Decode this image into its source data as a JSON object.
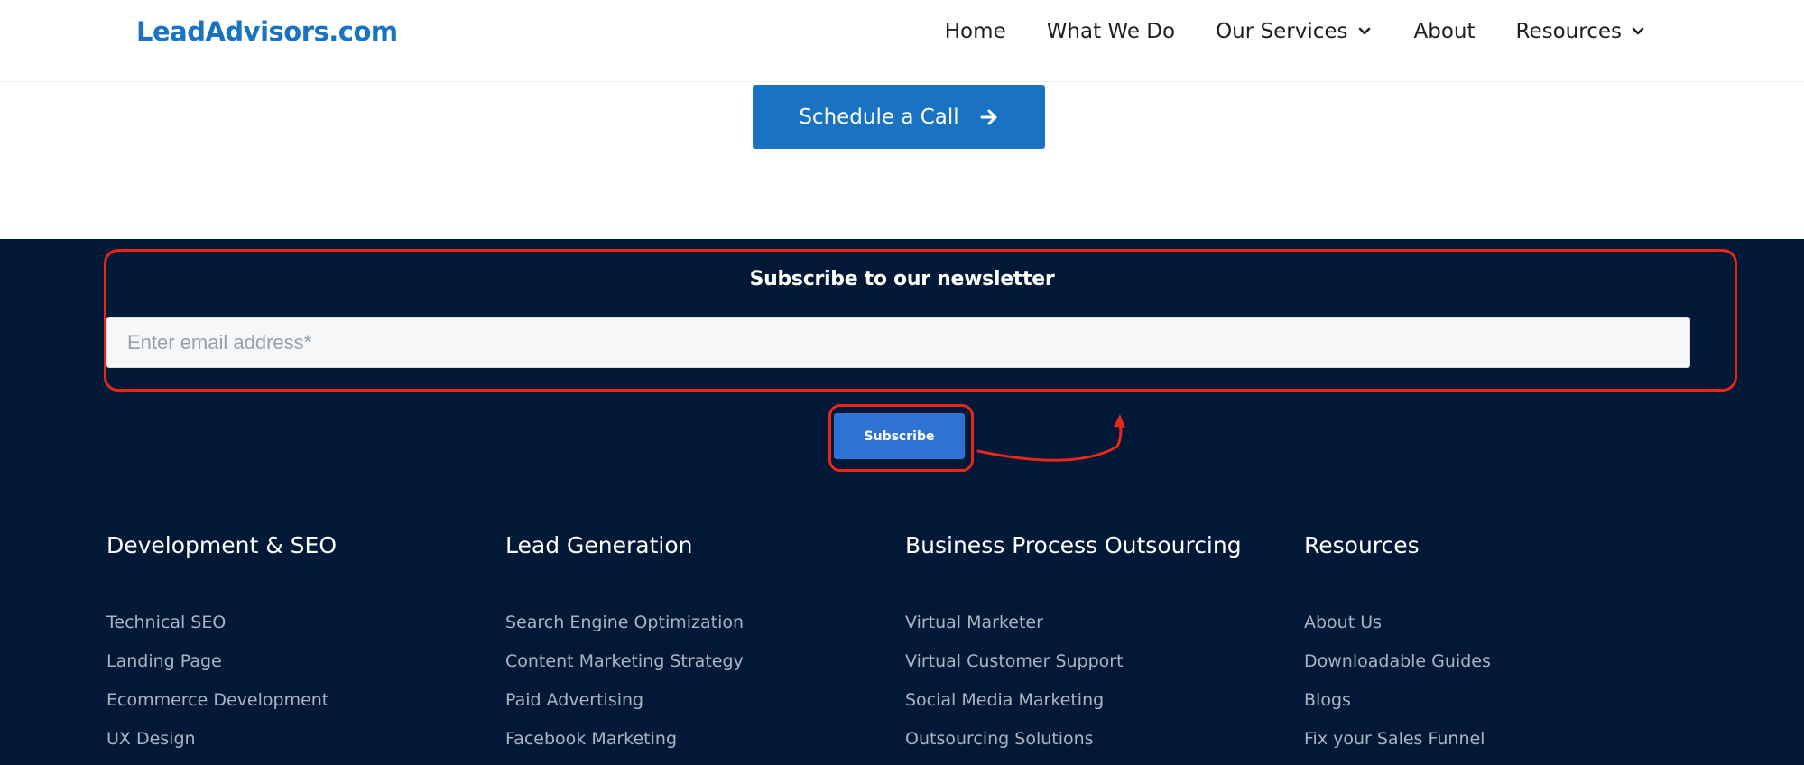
{
  "header": {
    "logo": "LeadAdvisors.com",
    "nav": [
      {
        "label": "Home",
        "has_dropdown": false
      },
      {
        "label": "What We Do",
        "has_dropdown": false
      },
      {
        "label": "Our Services",
        "has_dropdown": true
      },
      {
        "label": "About",
        "has_dropdown": false
      },
      {
        "label": "Resources",
        "has_dropdown": true
      }
    ]
  },
  "cta": {
    "label": "Schedule a Call",
    "icon": "arrow-right-icon"
  },
  "newsletter": {
    "title": "Subscribe to our newsletter",
    "email_placeholder": "Enter email address*",
    "email_value": "",
    "subscribe_label": "Subscribe"
  },
  "footer": {
    "columns": [
      {
        "title": "Development & SEO",
        "links": [
          "Technical SEO",
          "Landing Page",
          "Ecommerce Development",
          "UX Design"
        ]
      },
      {
        "title": "Lead Generation",
        "links": [
          "Search Engine Optimization",
          "Content Marketing Strategy",
          "Paid Advertising",
          "Facebook Marketing"
        ]
      },
      {
        "title": "Business Process Outsourcing",
        "links": [
          "Virtual Marketer",
          "Virtual Customer Support",
          "Social Media Marketing",
          "Outsourcing Solutions"
        ]
      },
      {
        "title": "Resources",
        "links": [
          "About Us",
          "Downloadable Guides",
          "Blogs",
          "Fix your Sales Funnel"
        ]
      }
    ]
  },
  "colors": {
    "brand_blue": "#1a73c2",
    "footer_bg": "#011936",
    "subscribe_blue": "#2e73d3",
    "annotation_red": "#e8271b"
  }
}
